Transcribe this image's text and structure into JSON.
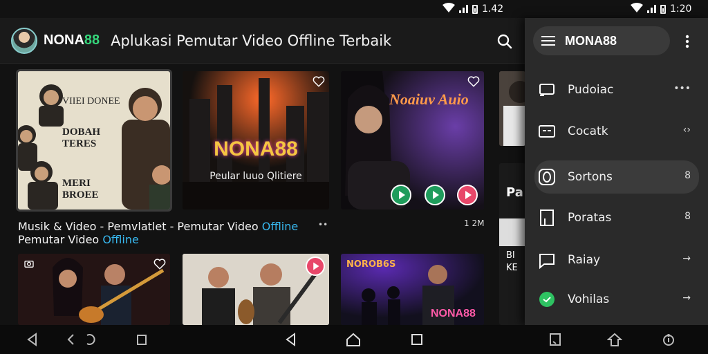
{
  "status_left": {
    "time": "1.42"
  },
  "status_right": {
    "time": "1:20"
  },
  "appbar": {
    "brand_main": "NONA",
    "brand_accent": "88",
    "title": "Aplukasi Pemutar Video Offline Terbaik",
    "search_icon": "search-icon"
  },
  "grid": {
    "cards": [
      {
        "name": "card-portraits",
        "lines": [
          "VIIEI DONEE",
          "DOBAH TERES",
          "MERI BROEE"
        ]
      },
      {
        "name": "card-nona88-city",
        "headline": "NONA88",
        "sub": "Peular luuo Qlitiere"
      },
      {
        "name": "card-singer",
        "headline": "Noaiuv Auio"
      },
      {
        "name": "card-guitar-duo"
      },
      {
        "name": "card-acoustic"
      },
      {
        "name": "card-concert",
        "badge": "NOROB6S",
        "headline": "NONA88"
      }
    ],
    "caption_main": "Musik & Video - Pemvlatlet - Pemutar Video ",
    "caption_hl": "Offline",
    "caption_line2": "Pemutar Video ",
    "caption_line2_hl": "Offline",
    "caption_dots": "••",
    "caption_count": "1 2M",
    "peek_text": "Pa",
    "peek_text2": "BI",
    "peek_text3": "KE"
  },
  "drawer": {
    "title": "MONA88",
    "items": [
      {
        "label": "Pudoiac",
        "trail": "•••",
        "icon": "cast-icon"
      },
      {
        "label": "Cocatk",
        "trail": "‹›",
        "icon": "caption-icon"
      },
      {
        "label": "Sortons",
        "trail": "8",
        "icon": "circle-o-icon"
      },
      {
        "label": "Poratas",
        "trail": "8",
        "icon": "page-icon"
      },
      {
        "label": "Raiay",
        "trail": "→",
        "icon": "chat-icon"
      },
      {
        "label": "Vohilas",
        "trail": "→",
        "icon": "green-dot-icon"
      }
    ]
  },
  "colors": {
    "accent_green": "#35d47a",
    "accent_blue": "#38b9f0",
    "play_green": "#1f9c5c",
    "play_pink": "#e8476a"
  }
}
